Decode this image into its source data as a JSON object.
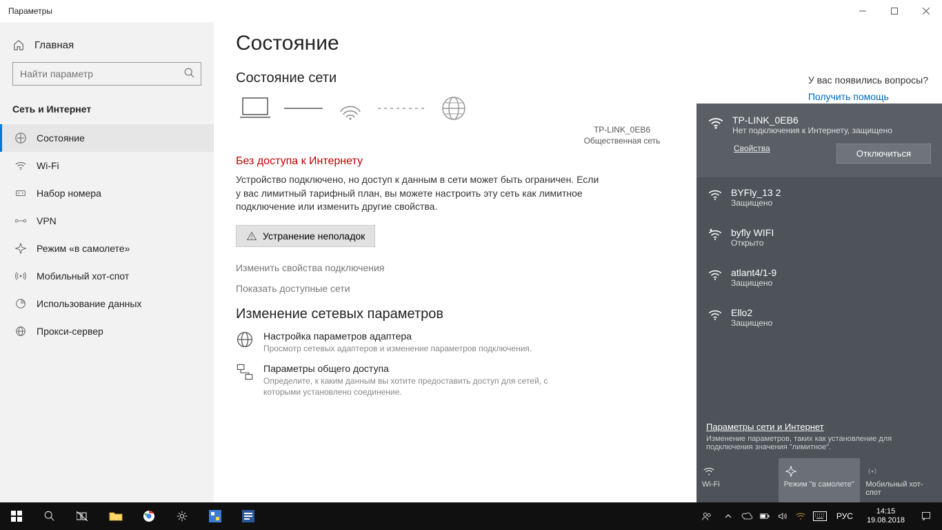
{
  "window": {
    "title": "Параметры"
  },
  "sidebar": {
    "home": "Главная",
    "search_placeholder": "Найти параметр",
    "category": "Сеть и Интернет",
    "items": [
      {
        "label": "Состояние"
      },
      {
        "label": "Wi-Fi"
      },
      {
        "label": "Набор номера"
      },
      {
        "label": "VPN"
      },
      {
        "label": "Режим «в самолете»"
      },
      {
        "label": "Мобильный хот-спот"
      },
      {
        "label": "Использование данных"
      },
      {
        "label": "Прокси-сервер"
      }
    ]
  },
  "content": {
    "h1": "Состояние",
    "h2_status": "Состояние сети",
    "net_name": "TP-LINK_0EB6",
    "net_type": "Общественная сеть",
    "warn_title": "Без доступа к Интернету",
    "warn_body": "Устройство подключено, но доступ к данным в сети может быть ограничен. Если у вас лимитный тарифный план, вы можете настроить эту сеть как лимитное подключение или изменить другие свойства.",
    "troubleshoot": "Устранение неполадок",
    "change_props": "Изменить свойства подключения",
    "show_nets": "Показать доступные сети",
    "h2_change": "Изменение сетевых параметров",
    "opt1_t": "Настройка параметров адаптера",
    "opt1_d": "Просмотр сетевых адаптеров и изменение параметров подключения.",
    "opt2_t": "Параметры общего доступа",
    "opt2_d": "Определите, к каким данным вы хотите предоставить доступ для сетей, с которыми установлено соединение."
  },
  "help": {
    "q": "У вас появились вопросы?",
    "link": "Получить помощь"
  },
  "flyout": {
    "current": {
      "name": "TP-LINK_0EB6",
      "sub": "Нет подключения к Интернету, защищено",
      "props": "Свойства",
      "disconnect": "Отключиться"
    },
    "networks": [
      {
        "name": "BYFly_13 2",
        "sub": "Защищено"
      },
      {
        "name": "byfly WIFI",
        "sub": "Открыто"
      },
      {
        "name": "atlant4/1-9",
        "sub": "Защищено"
      },
      {
        "name": "Ello2",
        "sub": "Защищено"
      }
    ],
    "footer_link": "Параметры сети и Интернет",
    "footer_desc": "Изменение параметров, таких как установление для подключения значения \"лимитное\".",
    "toggles": {
      "wifi": "Wi-Fi",
      "airplane": "Режим \"в самолете\"",
      "hotspot": "Мобильный хот-спот"
    }
  },
  "taskbar": {
    "lang": "РУС",
    "time": "14:15",
    "date": "19.08.2018"
  }
}
